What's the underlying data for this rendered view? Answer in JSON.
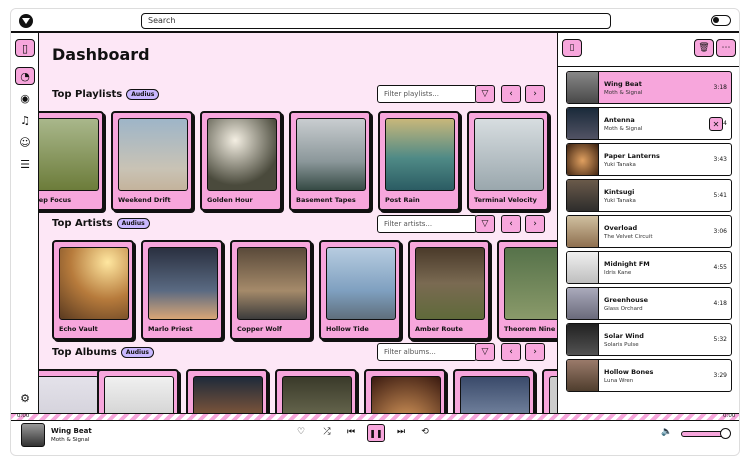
{
  "search": {
    "placeholder": "Search"
  },
  "main": {
    "title": "Dashboard",
    "playlists": {
      "title": "Top Playlists",
      "badge": "Audius",
      "filter_placeholder": "Filter playlists...",
      "items": [
        "Deep Focus",
        "Weekend Drift",
        "Golden Hour",
        "Basement Tapes",
        "Post Rain",
        "Terminal Velocity"
      ]
    },
    "artists": {
      "title": "Top Artists",
      "badge": "Audius",
      "filter_placeholder": "Filter artists...",
      "items": [
        "Echo Vault",
        "Marlo Priest",
        "Copper Wolf",
        "Hollow Tide",
        "Amber Route",
        "Theorem Nine"
      ]
    },
    "albums": {
      "title": "Top Albums",
      "badge": "Audius",
      "filter_placeholder": "Filter albums..."
    }
  },
  "queue": [
    {
      "title": "Wing Beat",
      "artist": "Moth & Signal",
      "duration": "3:18"
    },
    {
      "title": "Antenna",
      "artist": "Moth & Signal",
      "duration": "3:34"
    },
    {
      "title": "Paper Lanterns",
      "artist": "Yuki Tanaka",
      "duration": "3:43"
    },
    {
      "title": "Kintsugi",
      "artist": "Yuki Tanaka",
      "duration": "5:41"
    },
    {
      "title": "Overload",
      "artist": "The Velvet Circuit",
      "duration": "3:06"
    },
    {
      "title": "Midnight FM",
      "artist": "Idris Kane",
      "duration": "4:55"
    },
    {
      "title": "Greenhouse",
      "artist": "Glass Orchard",
      "duration": "4:18"
    },
    {
      "title": "Solar Wind",
      "artist": "Solaris Pulse",
      "duration": "5:32"
    },
    {
      "title": "Hollow Bones",
      "artist": "Luna Wren",
      "duration": "3:29"
    }
  ],
  "player": {
    "title": "Wing Beat",
    "artist": "Moth & Signal",
    "time_elapsed": "0:00",
    "time_total": "0:00",
    "progress": 0,
    "volume": 1.0
  },
  "colors": {
    "accent": "#f7a6dc",
    "background": "#fde7f6",
    "badge": "#c9b8ff"
  }
}
